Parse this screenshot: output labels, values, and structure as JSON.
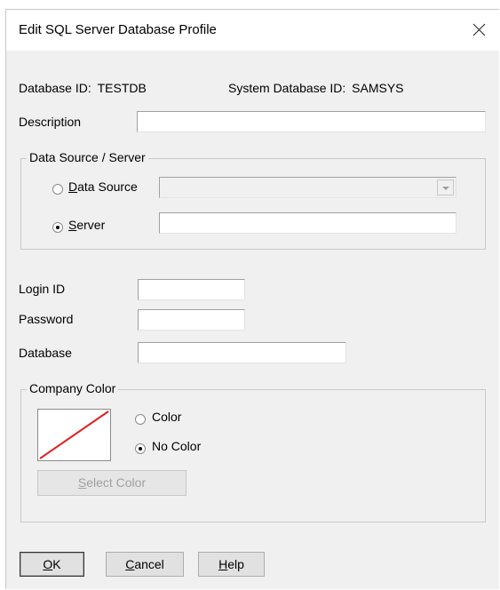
{
  "window": {
    "title": "Edit SQL Server Database Profile",
    "close_icon": "close-icon"
  },
  "ids": {
    "database_id_label": "Database ID:",
    "database_id_value": "TESTDB",
    "system_database_id_label": "System Database ID:",
    "system_database_id_value": "SAMSYS"
  },
  "description": {
    "label": "Description",
    "value": ""
  },
  "data_source_group": {
    "legend": "Data Source / Server",
    "data_source_radio": {
      "prefix": "",
      "accel": "D",
      "rest": "ata Source",
      "selected": false
    },
    "data_source_select": {
      "value": "",
      "enabled": false
    },
    "server_radio": {
      "accel": "S",
      "rest": "erver",
      "selected": true
    },
    "server_value": ""
  },
  "credentials": {
    "login_label": "Login ID",
    "login_value": "",
    "password_label": "Password",
    "password_value": "",
    "database_label": "Database",
    "database_value": ""
  },
  "company_color": {
    "legend": "Company Color",
    "color_radio": {
      "label": "Color",
      "selected": false
    },
    "no_color_radio": {
      "label": "No Color",
      "selected": true
    },
    "swatch_line_color": "#e02020",
    "select_button": {
      "accel": "S",
      "rest": "elect Color",
      "enabled": false
    }
  },
  "buttons": {
    "ok": {
      "accel": "O",
      "rest": "K"
    },
    "cancel": {
      "accel": "C",
      "rest": "ancel"
    },
    "help": {
      "accel": "H",
      "rest": "elp"
    }
  }
}
